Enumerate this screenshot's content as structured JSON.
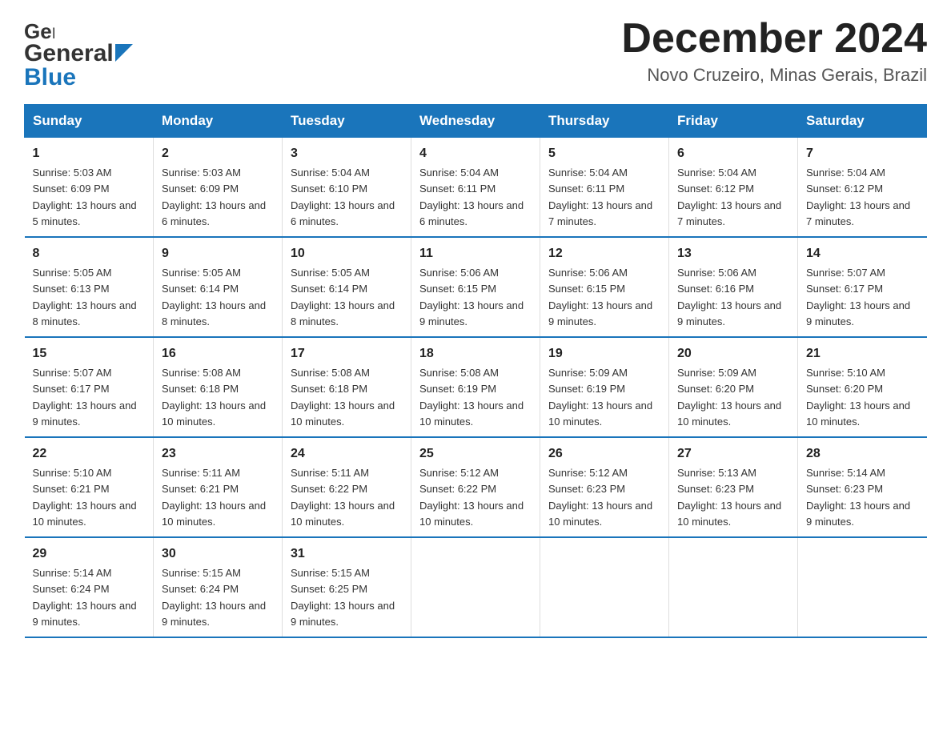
{
  "header": {
    "logo_general": "General",
    "logo_blue": "Blue",
    "month_title": "December 2024",
    "location": "Novo Cruzeiro, Minas Gerais, Brazil"
  },
  "days_of_week": [
    "Sunday",
    "Monday",
    "Tuesday",
    "Wednesday",
    "Thursday",
    "Friday",
    "Saturday"
  ],
  "weeks": [
    [
      {
        "day": "1",
        "sunrise": "5:03 AM",
        "sunset": "6:09 PM",
        "daylight": "13 hours and 5 minutes."
      },
      {
        "day": "2",
        "sunrise": "5:03 AM",
        "sunset": "6:09 PM",
        "daylight": "13 hours and 6 minutes."
      },
      {
        "day": "3",
        "sunrise": "5:04 AM",
        "sunset": "6:10 PM",
        "daylight": "13 hours and 6 minutes."
      },
      {
        "day": "4",
        "sunrise": "5:04 AM",
        "sunset": "6:11 PM",
        "daylight": "13 hours and 6 minutes."
      },
      {
        "day": "5",
        "sunrise": "5:04 AM",
        "sunset": "6:11 PM",
        "daylight": "13 hours and 7 minutes."
      },
      {
        "day": "6",
        "sunrise": "5:04 AM",
        "sunset": "6:12 PM",
        "daylight": "13 hours and 7 minutes."
      },
      {
        "day": "7",
        "sunrise": "5:04 AM",
        "sunset": "6:12 PM",
        "daylight": "13 hours and 7 minutes."
      }
    ],
    [
      {
        "day": "8",
        "sunrise": "5:05 AM",
        "sunset": "6:13 PM",
        "daylight": "13 hours and 8 minutes."
      },
      {
        "day": "9",
        "sunrise": "5:05 AM",
        "sunset": "6:14 PM",
        "daylight": "13 hours and 8 minutes."
      },
      {
        "day": "10",
        "sunrise": "5:05 AM",
        "sunset": "6:14 PM",
        "daylight": "13 hours and 8 minutes."
      },
      {
        "day": "11",
        "sunrise": "5:06 AM",
        "sunset": "6:15 PM",
        "daylight": "13 hours and 9 minutes."
      },
      {
        "day": "12",
        "sunrise": "5:06 AM",
        "sunset": "6:15 PM",
        "daylight": "13 hours and 9 minutes."
      },
      {
        "day": "13",
        "sunrise": "5:06 AM",
        "sunset": "6:16 PM",
        "daylight": "13 hours and 9 minutes."
      },
      {
        "day": "14",
        "sunrise": "5:07 AM",
        "sunset": "6:17 PM",
        "daylight": "13 hours and 9 minutes."
      }
    ],
    [
      {
        "day": "15",
        "sunrise": "5:07 AM",
        "sunset": "6:17 PM",
        "daylight": "13 hours and 9 minutes."
      },
      {
        "day": "16",
        "sunrise": "5:08 AM",
        "sunset": "6:18 PM",
        "daylight": "13 hours and 10 minutes."
      },
      {
        "day": "17",
        "sunrise": "5:08 AM",
        "sunset": "6:18 PM",
        "daylight": "13 hours and 10 minutes."
      },
      {
        "day": "18",
        "sunrise": "5:08 AM",
        "sunset": "6:19 PM",
        "daylight": "13 hours and 10 minutes."
      },
      {
        "day": "19",
        "sunrise": "5:09 AM",
        "sunset": "6:19 PM",
        "daylight": "13 hours and 10 minutes."
      },
      {
        "day": "20",
        "sunrise": "5:09 AM",
        "sunset": "6:20 PM",
        "daylight": "13 hours and 10 minutes."
      },
      {
        "day": "21",
        "sunrise": "5:10 AM",
        "sunset": "6:20 PM",
        "daylight": "13 hours and 10 minutes."
      }
    ],
    [
      {
        "day": "22",
        "sunrise": "5:10 AM",
        "sunset": "6:21 PM",
        "daylight": "13 hours and 10 minutes."
      },
      {
        "day": "23",
        "sunrise": "5:11 AM",
        "sunset": "6:21 PM",
        "daylight": "13 hours and 10 minutes."
      },
      {
        "day": "24",
        "sunrise": "5:11 AM",
        "sunset": "6:22 PM",
        "daylight": "13 hours and 10 minutes."
      },
      {
        "day": "25",
        "sunrise": "5:12 AM",
        "sunset": "6:22 PM",
        "daylight": "13 hours and 10 minutes."
      },
      {
        "day": "26",
        "sunrise": "5:12 AM",
        "sunset": "6:23 PM",
        "daylight": "13 hours and 10 minutes."
      },
      {
        "day": "27",
        "sunrise": "5:13 AM",
        "sunset": "6:23 PM",
        "daylight": "13 hours and 10 minutes."
      },
      {
        "day": "28",
        "sunrise": "5:14 AM",
        "sunset": "6:23 PM",
        "daylight": "13 hours and 9 minutes."
      }
    ],
    [
      {
        "day": "29",
        "sunrise": "5:14 AM",
        "sunset": "6:24 PM",
        "daylight": "13 hours and 9 minutes."
      },
      {
        "day": "30",
        "sunrise": "5:15 AM",
        "sunset": "6:24 PM",
        "daylight": "13 hours and 9 minutes."
      },
      {
        "day": "31",
        "sunrise": "5:15 AM",
        "sunset": "6:25 PM",
        "daylight": "13 hours and 9 minutes."
      },
      {
        "day": "",
        "sunrise": "",
        "sunset": "",
        "daylight": ""
      },
      {
        "day": "",
        "sunrise": "",
        "sunset": "",
        "daylight": ""
      },
      {
        "day": "",
        "sunrise": "",
        "sunset": "",
        "daylight": ""
      },
      {
        "day": "",
        "sunrise": "",
        "sunset": "",
        "daylight": ""
      }
    ]
  ],
  "labels": {
    "sunrise_prefix": "Sunrise: ",
    "sunset_prefix": "Sunset: ",
    "daylight_prefix": "Daylight: "
  }
}
